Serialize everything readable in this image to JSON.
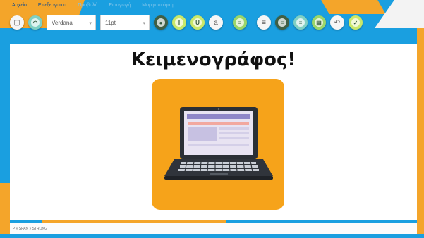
{
  "menu": {
    "items": [
      {
        "label": "Αρχείο",
        "dim": false
      },
      {
        "label": "Επεξεργασία",
        "dim": false
      },
      {
        "label": "Προβολή",
        "dim": true
      },
      {
        "label": "Εισαγωγή",
        "dim": true
      },
      {
        "label": "Μορφοποίηση",
        "dim": true
      }
    ]
  },
  "toolbar": {
    "font_value": "Verdana",
    "size_value": "11pt",
    "buttons": [
      {
        "name": "new-document-icon",
        "style": "white",
        "glyph": "▢"
      },
      {
        "name": "open-icon",
        "style": "teal",
        "glyph": "◠"
      },
      {
        "name": "paint-icon",
        "style": "dark",
        "glyph": "●"
      },
      {
        "name": "italic-icon",
        "style": "lime",
        "glyph": "I"
      },
      {
        "name": "underline-icon",
        "style": "lime",
        "glyph": "U"
      },
      {
        "name": "erase-icon",
        "style": "white",
        "glyph": "a"
      },
      {
        "name": "align-center-icon",
        "style": "green",
        "glyph": "≡"
      },
      {
        "name": "align-left-icon",
        "style": "white",
        "glyph": "≡"
      },
      {
        "name": "align-justify-icon",
        "style": "dark",
        "glyph": "≡"
      },
      {
        "name": "align-right-icon",
        "style": "teal",
        "glyph": "≡"
      },
      {
        "name": "indent-icon",
        "style": "green",
        "glyph": "▤"
      },
      {
        "name": "undo-icon",
        "style": "white",
        "glyph": "↶"
      },
      {
        "name": "check-icon",
        "style": "lime",
        "glyph": "✓"
      }
    ]
  },
  "document": {
    "title": "Κειμενογράφος!"
  },
  "status": {
    "text": "P » SPAN » STRONG"
  },
  "colors": {
    "accent_orange": "#f6a31a",
    "background_blue": "#1a9fe0"
  }
}
